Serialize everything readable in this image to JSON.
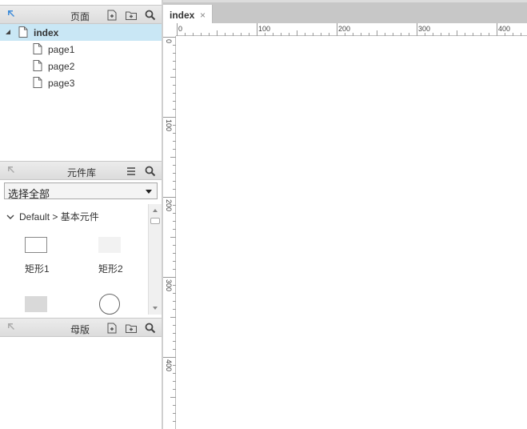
{
  "pages_panel": {
    "title": "页面",
    "items": [
      {
        "label": "index",
        "selected": true
      },
      {
        "label": "page1"
      },
      {
        "label": "page2"
      },
      {
        "label": "page3"
      }
    ]
  },
  "library_panel": {
    "title": "元件库",
    "select_value": "选择全部",
    "group_label": "Default > 基本元件",
    "widgets": [
      "矩形1",
      "矩形2"
    ]
  },
  "masters_panel": {
    "title": "母版"
  },
  "editor": {
    "tab_title": "index",
    "tab_close": "×",
    "ruler_h_labels": [
      "0",
      "100",
      "200",
      "300",
      "400"
    ],
    "ruler_v_labels": [
      "0",
      "100",
      "200",
      "300",
      "400"
    ]
  },
  "colors": {
    "selected_row": "#c9e7f5",
    "header_bg": "#dcdcdc",
    "accent_arrow": "#3b8ad9"
  },
  "icons": [
    "collapse-arrow-icon",
    "add-page-icon",
    "add-folder-icon",
    "search-icon",
    "menu-icon",
    "page-icon",
    "chevron-down-icon"
  ]
}
